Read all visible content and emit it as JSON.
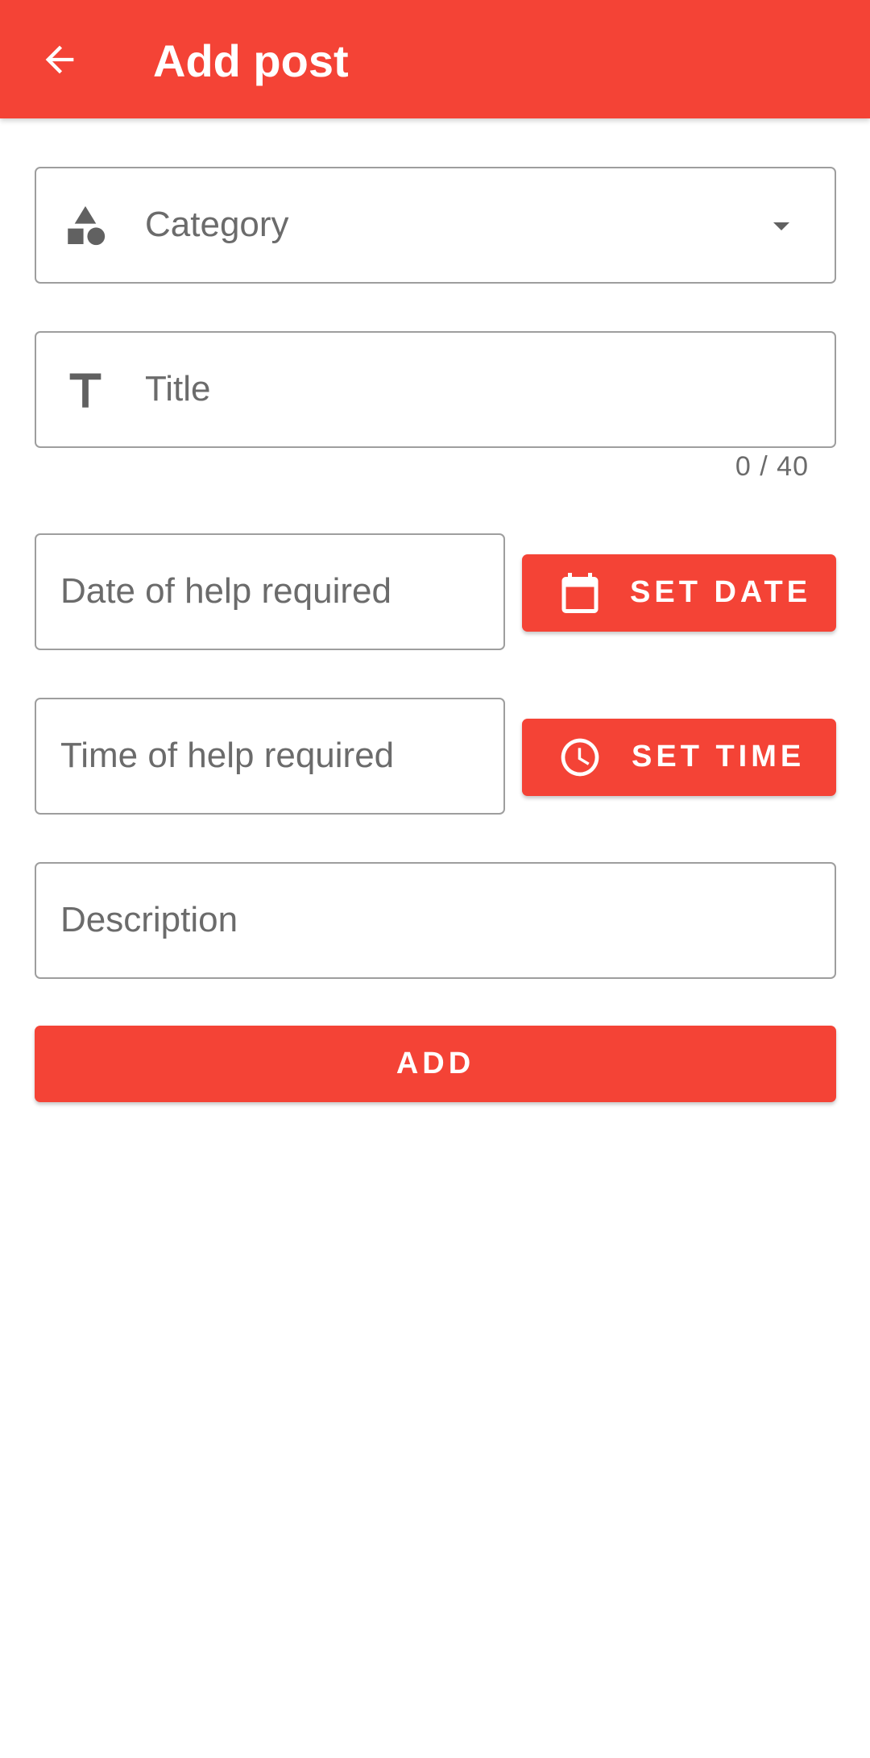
{
  "app_bar": {
    "title": "Add post",
    "back_icon": "arrow-left-icon",
    "background_color": "#f44336"
  },
  "form": {
    "category": {
      "placeholder": "Category",
      "icon": "shapes-icon",
      "dropdown_icon": "dropdown-arrow-icon"
    },
    "title": {
      "placeholder": "Title",
      "icon": "text-format-icon",
      "counter": "0 / 40"
    },
    "date": {
      "placeholder": "Date of help required",
      "button_label": "SET DATE",
      "button_icon": "calendar-icon"
    },
    "time": {
      "placeholder": "Time of help required",
      "button_label": "SET TIME",
      "button_icon": "clock-icon"
    },
    "description": {
      "placeholder": "Description"
    },
    "submit": {
      "label": "ADD"
    }
  },
  "colors": {
    "accent": "#f44336",
    "field_border": "#9e9e9e",
    "hint_text": "#6b6b6b"
  }
}
